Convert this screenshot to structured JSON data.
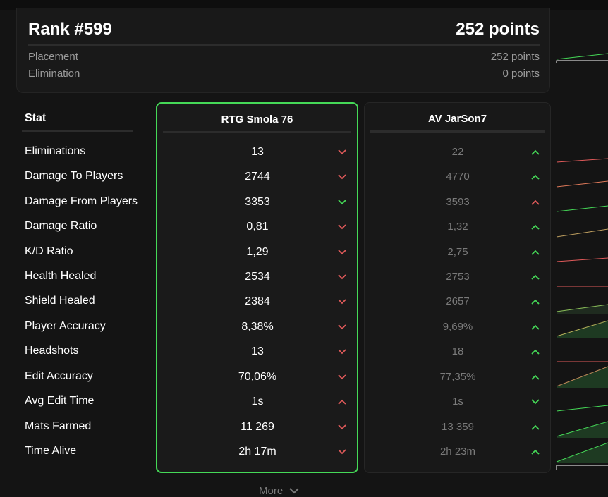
{
  "rank": {
    "title": "Rank #599",
    "total": "252 points",
    "rows": [
      {
        "label": "Placement",
        "value": "252 points"
      },
      {
        "label": "Elimination",
        "value": "0 points"
      }
    ]
  },
  "table": {
    "stat_header": "Stat",
    "stats": [
      "Eliminations",
      "Damage To Players",
      "Damage From Players",
      "Damage Ratio",
      "K/D Ratio",
      "Health Healed",
      "Shield Healed",
      "Player Accuracy",
      "Headshots",
      "Edit Accuracy",
      "Avg Edit Time",
      "Mats Farmed",
      "Time Alive"
    ],
    "players": [
      {
        "name": "RTG Smola 76",
        "values": [
          "13",
          "2744",
          "3353",
          "0,81",
          "1,29",
          "2534",
          "2384",
          "8,38%",
          "13",
          "70,06%",
          "1s",
          "11 269",
          "2h 17m"
        ],
        "trends": [
          "down-red",
          "down-red",
          "down-green",
          "down-red",
          "down-red",
          "down-red",
          "down-red",
          "down-red",
          "down-red",
          "down-red",
          "up-red",
          "down-red",
          "down-red"
        ]
      },
      {
        "name": "AV JarSon7",
        "values": [
          "22",
          "4770",
          "3593",
          "1,32",
          "2,75",
          "2753",
          "2657",
          "9,69%",
          "18",
          "77,35%",
          "1s",
          "13 359",
          "2h 23m"
        ],
        "trends": [
          "up-green",
          "up-green",
          "up-red",
          "up-green",
          "up-green",
          "up-green",
          "up-green",
          "up-green",
          "up-green",
          "up-green",
          "down-green",
          "up-green",
          "up-green"
        ]
      }
    ]
  },
  "more_label": "More",
  "colors": {
    "accent_green": "#45d957",
    "down_red": "#e05a5a",
    "muted_text": "#9a9a9a"
  }
}
